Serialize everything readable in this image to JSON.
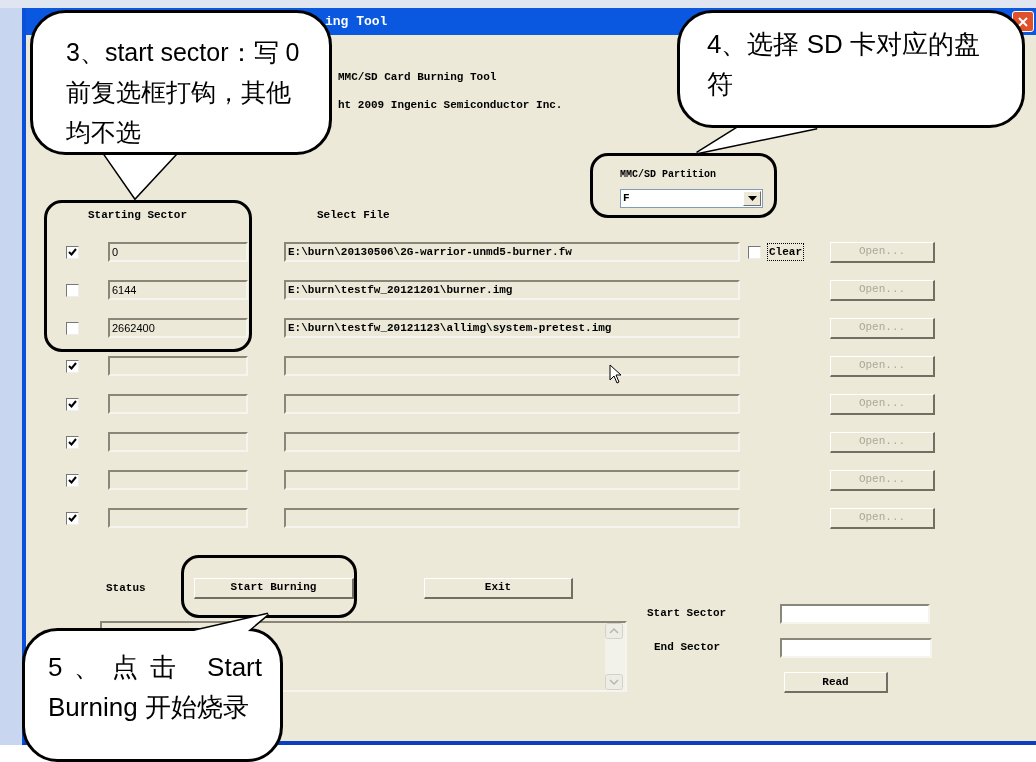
{
  "window": {
    "title": "ing Tool"
  },
  "header": {
    "product": "MMC/SD Card Burning Tool",
    "copyright": "ht 2009 Ingenic Semiconductor Inc."
  },
  "partition": {
    "label": "MMC/SD Partition",
    "value": "F"
  },
  "columns": {
    "sector": "Starting Sector",
    "file": "Select File"
  },
  "rows": [
    {
      "checked": true,
      "sector": "0",
      "file": "E:\\burn\\20130506\\2G-warrior-unmd5-burner.fw",
      "clear": {
        "label": "Clear",
        "checked": false
      },
      "open": {
        "label": "Open...",
        "disabled": true
      }
    },
    {
      "checked": false,
      "sector": "6144",
      "file": "E:\\burn\\testfw_20121201\\burner.img",
      "open": {
        "label": "Open...",
        "disabled": true
      }
    },
    {
      "checked": false,
      "sector": "2662400",
      "file": "E:\\burn\\testfw_20121123\\allimg\\system-pretest.img",
      "open": {
        "label": "Open...",
        "disabled": true
      }
    },
    {
      "checked": true,
      "open": {
        "label": "Open...",
        "disabled": true
      }
    },
    {
      "checked": true,
      "open": {
        "label": "Open...",
        "disabled": true
      }
    },
    {
      "checked": true,
      "open": {
        "label": "Open...",
        "disabled": true
      }
    },
    {
      "checked": true,
      "open": {
        "label": "Open...",
        "disabled": true
      }
    },
    {
      "checked": true,
      "open": {
        "label": "Open...",
        "disabled": true
      }
    }
  ],
  "status": {
    "label": "Status"
  },
  "buttons": {
    "start": "Start Burning",
    "exit": "Exit"
  },
  "read": {
    "start_label": "Start Sector",
    "end_label": "End Sector",
    "button": "Read"
  },
  "annotations": [
    {
      "text": "3、start sector：写 0 前复选框打钩，其他均不选"
    },
    {
      "text": "4、选择 SD 卡对应的盘符"
    },
    {
      "text": "5、点击 Start Burning 开始烧录"
    }
  ]
}
